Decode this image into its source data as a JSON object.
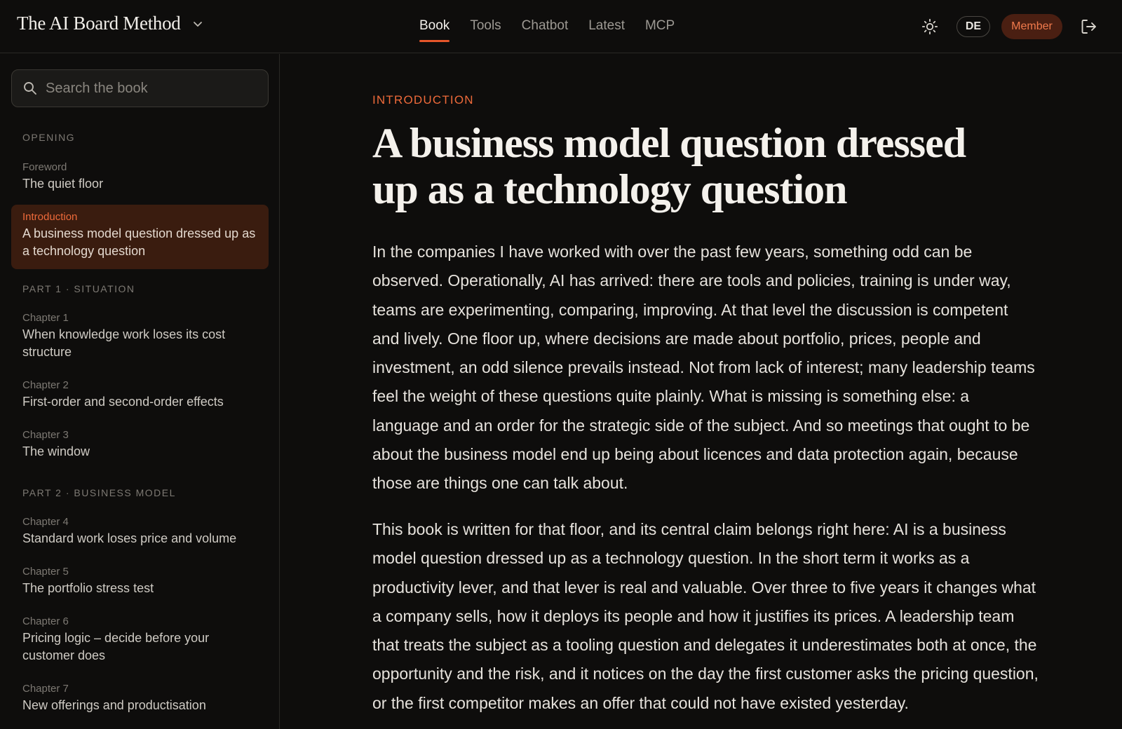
{
  "header": {
    "brand": "The AI Board Method",
    "nav": [
      {
        "label": "Book",
        "active": true
      },
      {
        "label": "Tools",
        "active": false
      },
      {
        "label": "Chatbot",
        "active": false
      },
      {
        "label": "Latest",
        "active": false
      },
      {
        "label": "MCP",
        "active": false
      }
    ],
    "lang_label": "DE",
    "member_label": "Member",
    "icons": [
      "chevron-down-icon",
      "sun-icon",
      "logout-icon"
    ]
  },
  "colors": {
    "accent": "#e6562a",
    "background": "#0e0d0c",
    "active_item_bg": "#3a1c0f"
  },
  "sidebar": {
    "search_placeholder": "Search the book",
    "sections": {
      "opening": "OPENING",
      "part1": "PART 1 · SITUATION",
      "part2": "PART 2 · BUSINESS MODEL"
    },
    "items": [
      {
        "kicker": "Foreword",
        "title": "The quiet floor"
      },
      {
        "kicker": "Introduction",
        "title": "A business model question dressed up as a technology question",
        "active": true
      },
      {
        "kicker": "Chapter 1",
        "title": "When knowledge work loses its cost structure"
      },
      {
        "kicker": "Chapter 2",
        "title": "First-order and second-order effects"
      },
      {
        "kicker": "Chapter 3",
        "title": "The window"
      },
      {
        "kicker": "Chapter 4",
        "title": "Standard work loses price and volume"
      },
      {
        "kicker": "Chapter 5",
        "title": "The portfolio stress test"
      },
      {
        "kicker": "Chapter 6",
        "title": "Pricing logic – decide before your customer does"
      },
      {
        "kicker": "Chapter 7",
        "title": "New offerings and productisation"
      }
    ]
  },
  "main": {
    "eyebrow": "INTRODUCTION",
    "title": "A business model question dressed up as a technology question",
    "paragraphs": [
      "In the companies I have worked with over the past few years, something odd can be observed. Operationally, AI has arrived: there are tools and policies, training is under way, teams are experimenting, comparing, improving. At that level the discussion is competent and lively. One floor up, where decisions are made about portfolio, prices, people and investment, an odd silence prevails instead. Not from lack of interest; many leadership teams feel the weight of these questions quite plainly. What is missing is something else: a language and an order for the strategic side of the subject. And so meetings that ought to be about the business model end up being about licences and data protection again, because those are things one can talk about.",
      "This book is written for that floor, and its central claim belongs right here: AI is a business model question dressed up as a technology question. In the short term it works as a productivity lever, and that lever is real and valuable. Over three to five years it changes what a company sells, how it deploys its people and how it justifies its prices. A leadership team that treats the subject as a tooling question and delegates it underestimates both at once, the opportunity and the risk, and it notices on the day the first customer asks the pricing question, or the first competitor makes an offer that could not have existed yesterday."
    ]
  }
}
